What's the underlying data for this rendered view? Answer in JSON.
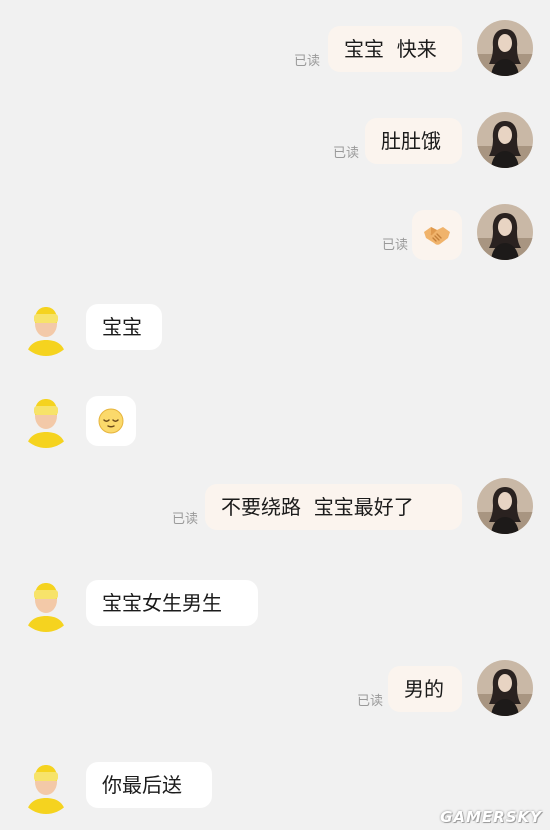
{
  "messages": [
    {
      "side": "out",
      "text": "宝宝  快来",
      "status": "已读"
    },
    {
      "side": "out",
      "text": "肚肚饿",
      "status": "已读"
    },
    {
      "side": "out",
      "emoji": "handshake-emoji",
      "status": "已读"
    },
    {
      "side": "in",
      "text": "宝宝"
    },
    {
      "side": "in",
      "emoji": "relieved-face-emoji"
    },
    {
      "side": "out",
      "text": "不要绕路  宝宝最好了",
      "status": "已读"
    },
    {
      "side": "in",
      "text": "宝宝女生男生"
    },
    {
      "side": "out",
      "text": "男的",
      "status": "已读"
    },
    {
      "side": "in",
      "text": "你最后送"
    }
  ],
  "watermark": "GAMERSKY",
  "colors": {
    "background": "#f1f1f1",
    "outgoing_bubble": "#fbf4ee",
    "incoming_bubble": "#ffffff",
    "read_status": "#9a9a9a"
  }
}
